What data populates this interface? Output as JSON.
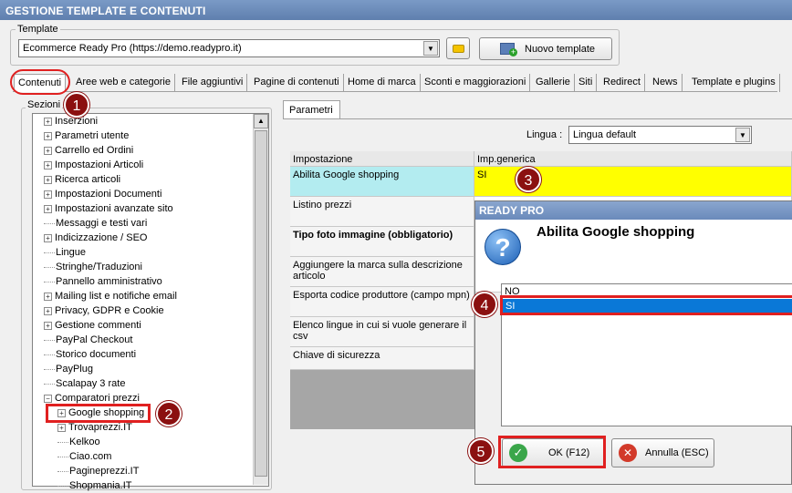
{
  "window": {
    "title": "GESTIONE TEMPLATE E CONTENUTI"
  },
  "template_group": {
    "legend": "Template",
    "selected": "Ecommerce Ready Pro (https://demo.readypro.it)",
    "new_button": "Nuovo template"
  },
  "tabs": [
    "Contenuti",
    "Aree web e categorie",
    "File aggiuntivi",
    "Pagine di contenuti",
    "Home di marca",
    "Sconti e maggiorazioni",
    "Gallerie",
    "Siti",
    "Redirect",
    "News",
    "Template e plugins"
  ],
  "sections": {
    "legend": "Sezioni",
    "items": [
      {
        "label": "Inserzioni",
        "expandable": true
      },
      {
        "label": "Parametri utente",
        "expandable": true
      },
      {
        "label": "Carrello ed Ordini",
        "expandable": true
      },
      {
        "label": "Impostazioni Articoli",
        "expandable": true
      },
      {
        "label": "Ricerca articoli",
        "expandable": true
      },
      {
        "label": "Impostazioni Documenti",
        "expandable": true
      },
      {
        "label": "Impostazioni avanzate sito",
        "expandable": true
      },
      {
        "label": "Messaggi e testi vari",
        "expandable": false
      },
      {
        "label": "Indicizzazione / SEO",
        "expandable": true
      },
      {
        "label": "Lingue",
        "expandable": false
      },
      {
        "label": "Stringhe/Traduzioni",
        "expandable": false
      },
      {
        "label": "Pannello amministrativo",
        "expandable": false
      },
      {
        "label": "Mailing list e notifiche email",
        "expandable": true
      },
      {
        "label": "Privacy, GDPR e Cookie",
        "expandable": true
      },
      {
        "label": "Gestione commenti",
        "expandable": true
      },
      {
        "label": "PayPal Checkout",
        "expandable": false
      },
      {
        "label": "Storico documenti",
        "expandable": false
      },
      {
        "label": "PayPlug",
        "expandable": false
      },
      {
        "label": "Scalapay 3 rate",
        "expandable": false
      },
      {
        "label": "Comparatori prezzi",
        "expandable": "open"
      }
    ],
    "sub_items": [
      {
        "label": "Google shopping",
        "expandable": true
      },
      {
        "label": "Trovaprezzi.IT",
        "expandable": true
      },
      {
        "label": "Kelkoo",
        "expandable": false
      },
      {
        "label": "Ciao.com",
        "expandable": false
      },
      {
        "label": "Pagineprezzi.IT",
        "expandable": false
      },
      {
        "label": "Shopmania.IT",
        "expandable": false
      }
    ]
  },
  "params": {
    "tab": "Parametri",
    "lingua_label": "Lingua :",
    "lingua_value": "Lingua default",
    "col_setting": "Impostazione",
    "col_value": "Imp.generica",
    "rows": [
      {
        "label": "Abilita Google shopping",
        "value": "SI"
      },
      {
        "label": "Listino prezzi",
        "value": ""
      },
      {
        "label": "Tipo foto immagine (obbligatorio)",
        "value": ""
      },
      {
        "label": "Aggiungere la marca sulla descrizione articolo",
        "value": ""
      },
      {
        "label": "Esporta codice produttore (campo mpn)",
        "value": ""
      },
      {
        "label": "Elenco lingue in cui si vuole generare il csv",
        "value": ""
      },
      {
        "label": "Chiave di sicurezza",
        "value": ""
      }
    ]
  },
  "dialog": {
    "title": "READY PRO",
    "question": "Abilita Google shopping",
    "options": [
      "NO",
      "SI"
    ],
    "selected": "SI",
    "ok": "OK (F12)",
    "cancel": "Annulla (ESC)"
  },
  "callouts": [
    "1",
    "2",
    "3",
    "4",
    "5"
  ],
  "colors": {
    "highlight": "#ffff00",
    "selected_row": "#0a78d7",
    "row_highlight": "#b3ecf0",
    "badge": "#8b1010",
    "title_bar": "#6b8bbd"
  }
}
